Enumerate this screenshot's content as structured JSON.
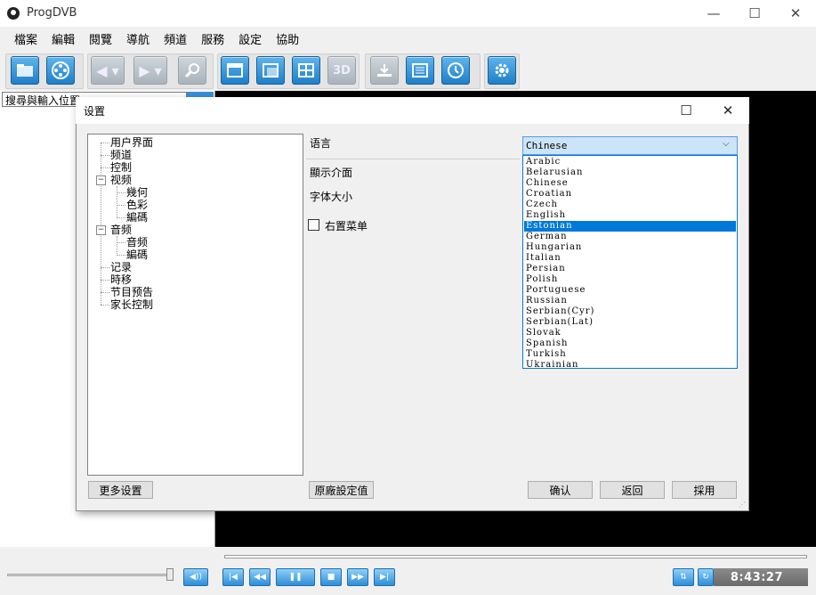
{
  "window": {
    "title": "ProgDVB",
    "minimize": "—",
    "maximize": "☐",
    "close": "✕"
  },
  "menubar": [
    "檔案",
    "編輯",
    "閱覽",
    "導航",
    "頻道",
    "服務",
    "設定",
    "協助"
  ],
  "search": {
    "value": "搜尋與輸入位置"
  },
  "toolbar": {
    "buttons": [
      "open-icon",
      "reel-icon",
      "back-icon",
      "forward-icon",
      "search-icon",
      "window-icon",
      "layout-icon",
      "grid-icon",
      "3d-icon",
      "record-icon",
      "list-icon",
      "clock-icon",
      "settings-icon"
    ],
    "label_3d": "3D"
  },
  "player": {
    "time": "8:43:27"
  },
  "dialog": {
    "title": "设置",
    "tree": [
      {
        "label": "用户界面",
        "level": 0
      },
      {
        "label": "频道",
        "level": 0
      },
      {
        "label": "控制",
        "level": 0
      },
      {
        "label": "视频",
        "level": 0,
        "expander": "−"
      },
      {
        "label": "幾何",
        "level": 1
      },
      {
        "label": "色彩",
        "level": 1
      },
      {
        "label": "編碼",
        "level": 1
      },
      {
        "label": "音频",
        "level": 0,
        "expander": "−"
      },
      {
        "label": "音频",
        "level": 1
      },
      {
        "label": "編碼",
        "level": 1
      },
      {
        "label": "记录",
        "level": 0
      },
      {
        "label": "時移",
        "level": 0
      },
      {
        "label": "节目预告",
        "level": 0
      },
      {
        "label": "家长控制",
        "level": 0
      }
    ],
    "language_label": "语言",
    "display_label": "顯示介面",
    "font_size_label": "字体大小",
    "menu_right_label": "右置菜单",
    "language_selected": "Chinese",
    "language_options": [
      "Arabic",
      "Belarusian",
      "Chinese",
      "Croatian",
      "Czech",
      "English",
      "Estonian",
      "German",
      "Hungarian",
      "Italian",
      "Persian",
      "Polish",
      "Portuguese",
      "Russian",
      "Serbian(Cyr)",
      "Serbian(Lat)",
      "Slovak",
      "Spanish",
      "Turkish",
      "Ukrainian"
    ],
    "highlighted_option": "Estonian",
    "buttons": {
      "more_settings": "更多设置",
      "defaults": "原廠設定值",
      "ok": "确认",
      "back": "返回",
      "apply": "採用"
    },
    "close": "✕",
    "maximize": "☐"
  }
}
